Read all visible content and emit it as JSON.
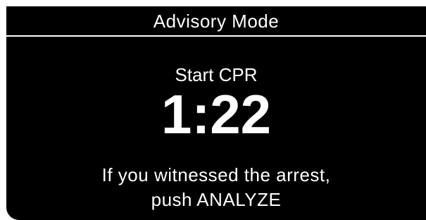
{
  "header": {
    "title": "Advisory Mode"
  },
  "main": {
    "prompt": "Start CPR",
    "timer": "1:22",
    "message_line1": "If you witnessed the arrest,",
    "message_line2": "push ANALYZE"
  },
  "colors": {
    "background": "#000000",
    "text": "#ffffff",
    "frame": "#ffffff"
  }
}
